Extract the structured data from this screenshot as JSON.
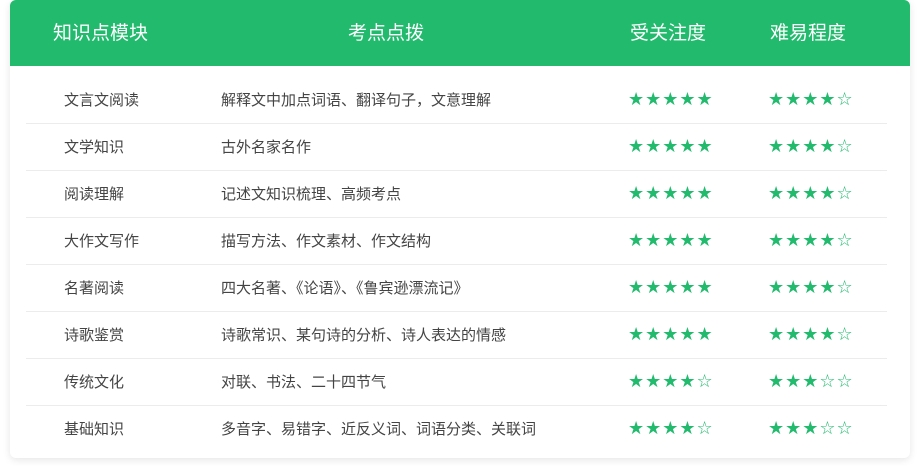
{
  "header": {
    "col_module": "知识点模块",
    "col_point": "考点点拨",
    "col_attention": "受关注度",
    "col_difficulty": "难易程度"
  },
  "rows": [
    {
      "module": "文言文阅读",
      "point": "解释文中加点词语、翻译句子，文意理解",
      "attention": "★★★★★",
      "difficulty": "★★★★☆"
    },
    {
      "module": "文学知识",
      "point": "古外名家名作",
      "attention": "★★★★★",
      "difficulty": "★★★★☆"
    },
    {
      "module": "阅读理解",
      "point": "记述文知识梳理、高频考点",
      "attention": "★★★★★",
      "difficulty": "★★★★☆"
    },
    {
      "module": "大作文写作",
      "point": "描写方法、作文素材、作文结构",
      "attention": "★★★★★",
      "difficulty": "★★★★☆"
    },
    {
      "module": "名著阅读",
      "point": "四大名著、《论语》、《鲁宾逊漂流记》",
      "attention": "★★★★★",
      "difficulty": "★★★★☆"
    },
    {
      "module": "诗歌鉴赏",
      "point": "诗歌常识、某句诗的分析、诗人表达的情感",
      "attention": "★★★★★",
      "difficulty": "★★★★☆"
    },
    {
      "module": "传统文化",
      "point": "对联、书法、二十四节气",
      "attention": "★★★★☆",
      "difficulty": "★★★☆☆"
    },
    {
      "module": "基础知识",
      "point": "多音字、易错字、近反义词、词语分类、关联词",
      "attention": "★★★★☆",
      "difficulty": "★★★☆☆"
    }
  ],
  "colors": {
    "accent": "#22bb6e",
    "text": "#444444",
    "divider": "#ececec"
  }
}
